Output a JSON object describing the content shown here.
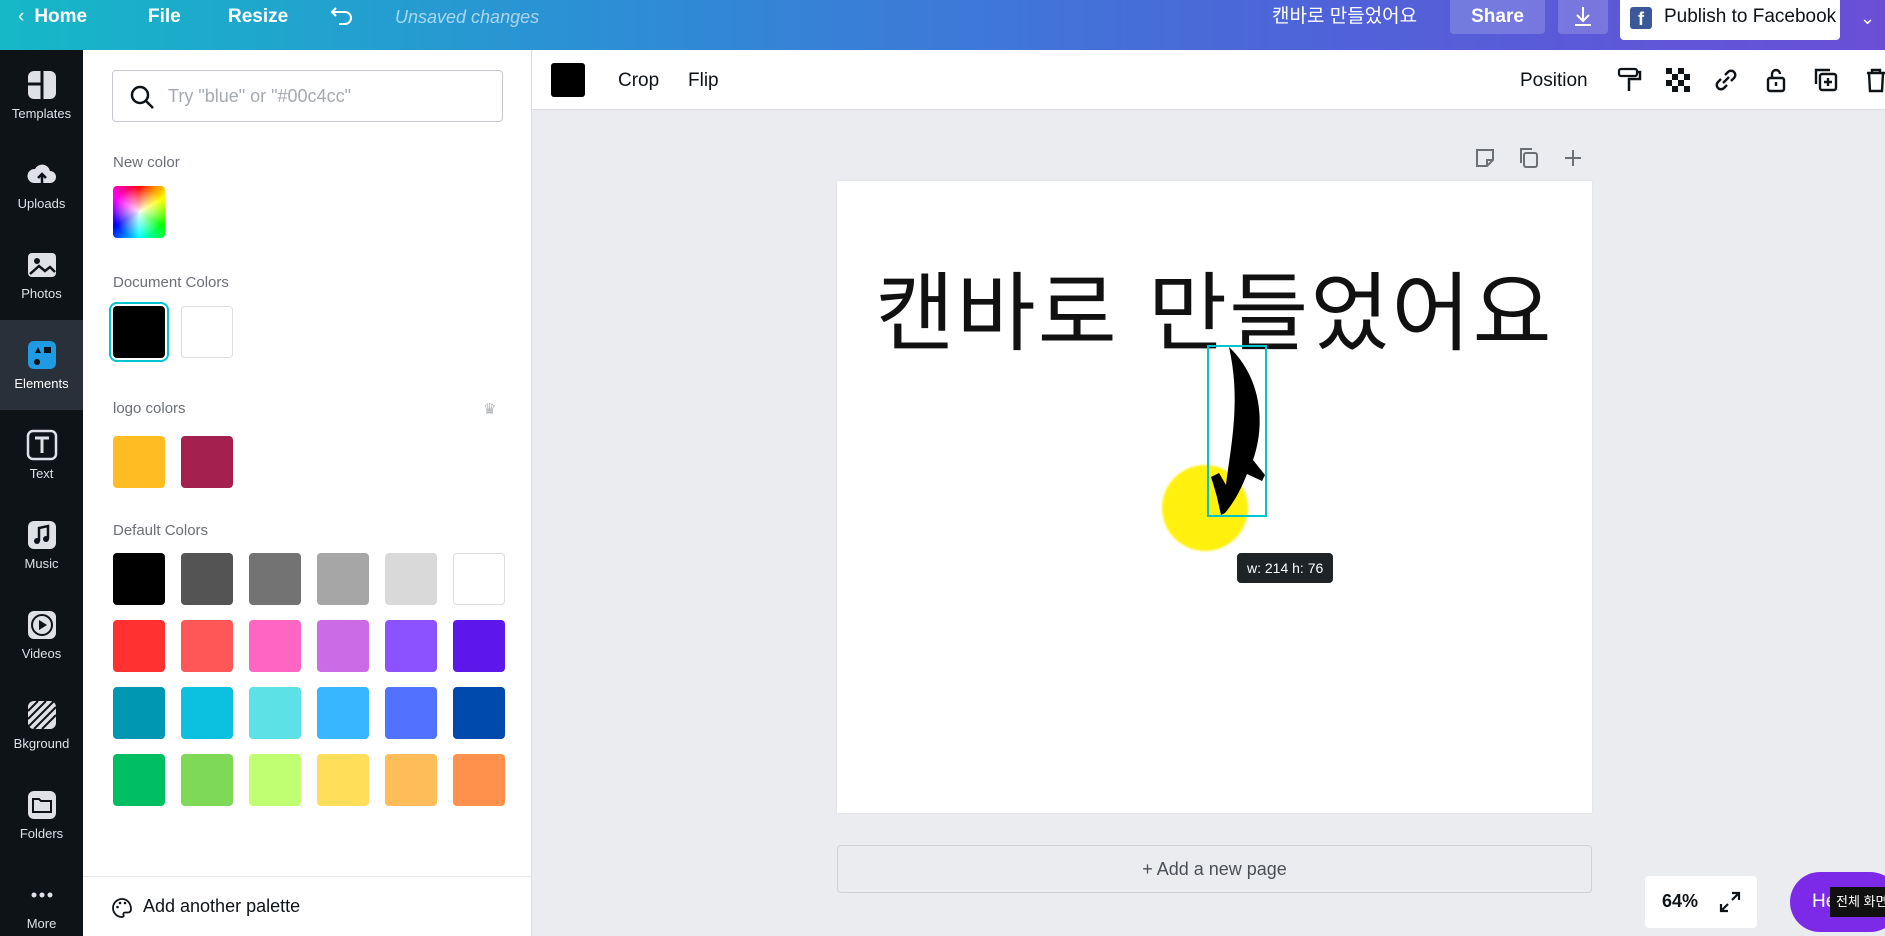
{
  "topbar": {
    "home": "Home",
    "file": "File",
    "resize": "Resize",
    "unsaved": "Unsaved changes",
    "doc_title": "캔바로 만들었어요",
    "share": "Share",
    "publish": "Publish to Facebook"
  },
  "rail": {
    "items": [
      {
        "label": "Templates",
        "icon": "templates-icon"
      },
      {
        "label": "Uploads",
        "icon": "upload-icon"
      },
      {
        "label": "Photos",
        "icon": "photo-icon"
      },
      {
        "label": "Elements",
        "icon": "elements-icon"
      },
      {
        "label": "Text",
        "icon": "text-icon"
      },
      {
        "label": "Music",
        "icon": "music-icon"
      },
      {
        "label": "Videos",
        "icon": "video-icon"
      },
      {
        "label": "Bkground",
        "icon": "background-icon"
      },
      {
        "label": "Folders",
        "icon": "folder-icon"
      },
      {
        "label": "More",
        "icon": "more-icon"
      }
    ],
    "active": "Elements"
  },
  "panel": {
    "search_placeholder": "Try \"blue\" or \"#00c4cc\"",
    "new_color_label": "New color",
    "document_colors_label": "Document Colors",
    "document_colors": [
      "#000000",
      "#ffffff"
    ],
    "logo_colors_label": "logo colors",
    "logo_colors": [
      "#ffbd23",
      "#a3204f"
    ],
    "default_colors_label": "Default Colors",
    "default_colors": [
      [
        "#000000",
        "#545454",
        "#737373",
        "#a6a6a6",
        "#d9d9d9",
        "#ffffff"
      ],
      [
        "#ff3131",
        "#ff5757",
        "#ff66c4",
        "#cb6ce6",
        "#8c52ff",
        "#5e17eb"
      ],
      [
        "#0097b2",
        "#0cc0df",
        "#5ce1e6",
        "#38b6ff",
        "#5271ff",
        "#004aad"
      ],
      [
        "#00bf63",
        "#7ed957",
        "#c1ff72",
        "#ffde59",
        "#ffbd59",
        "#ff914d"
      ]
    ],
    "add_palette": "Add another palette"
  },
  "toolbar": {
    "crop": "Crop",
    "flip": "Flip",
    "position": "Position"
  },
  "canvas": {
    "heading": "캔바로 만들었어요",
    "size_tooltip": "w: 214 h: 76",
    "add_page": "+ Add a new page"
  },
  "footer": {
    "zoom": "64%",
    "help": "He",
    "fullscreen_tip": "전체 화면"
  }
}
